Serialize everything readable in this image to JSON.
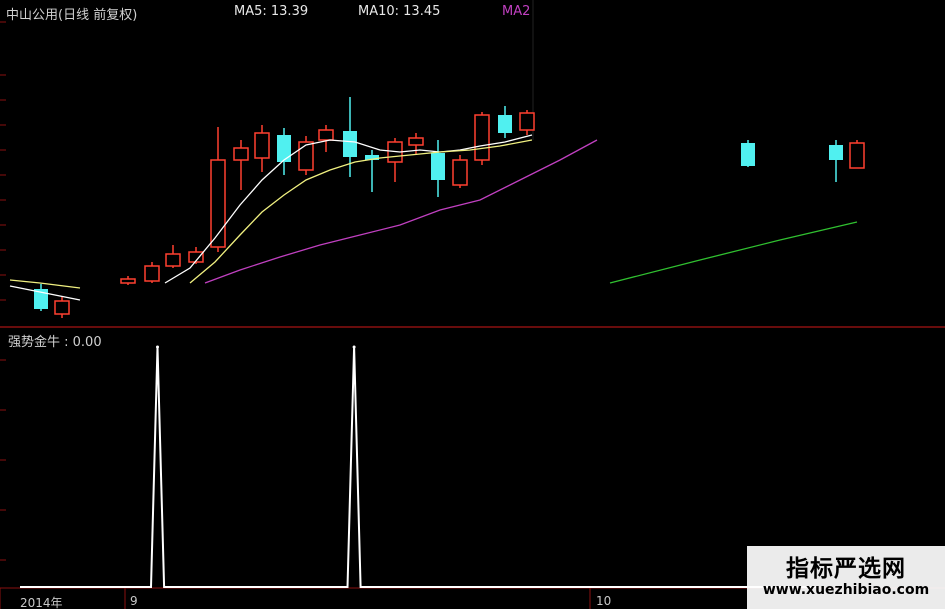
{
  "header": {
    "title": "中山公用(日线 前复权)",
    "ma5": "MA5: 13.39",
    "ma10": "MA10: 13.45",
    "ma20": "MA2"
  },
  "indicator": {
    "label": "强势金牛 : 0.00",
    "values": [
      0,
      0,
      0,
      0,
      0,
      0,
      0,
      0,
      0,
      0,
      0,
      0,
      0,
      0,
      0,
      0,
      0,
      0,
      0,
      0,
      0,
      1,
      0,
      0,
      0,
      0,
      0,
      0,
      0,
      0,
      0,
      0,
      0,
      0,
      0,
      0,
      0,
      0,
      0,
      0,
      0,
      0,
      0,
      0,
      0,
      0,
      0,
      0,
      0,
      0,
      0,
      1,
      0,
      0,
      0,
      0,
      0,
      0,
      0,
      0,
      0,
      0,
      0,
      0,
      0,
      0,
      0,
      0,
      0,
      0,
      0,
      0,
      0,
      0,
      0,
      0,
      0,
      0,
      0,
      0,
      0,
      0,
      0,
      0,
      0,
      0,
      0,
      0,
      0,
      0,
      0,
      0,
      0,
      0,
      0,
      0,
      0,
      0,
      0,
      0,
      0,
      0,
      0,
      0,
      0,
      0,
      0,
      0,
      0,
      0,
      0,
      0,
      0,
      0,
      0,
      0,
      0,
      0,
      0,
      0,
      0,
      0,
      0
    ]
  },
  "x_axis": {
    "labels": [
      "2014年",
      "9",
      "10"
    ]
  },
  "watermark": {
    "title": "指标严选网",
    "url": "www.xuezhibiao.com"
  },
  "colors": {
    "up": "#ff4030",
    "down": "#50f0f0",
    "ma5": "#ffffff",
    "ma10": "#f0f080",
    "ma20": "#c040c0",
    "ma60": "#30c030",
    "indicator": "#ffffff",
    "grid": "#8a1010"
  }
}
